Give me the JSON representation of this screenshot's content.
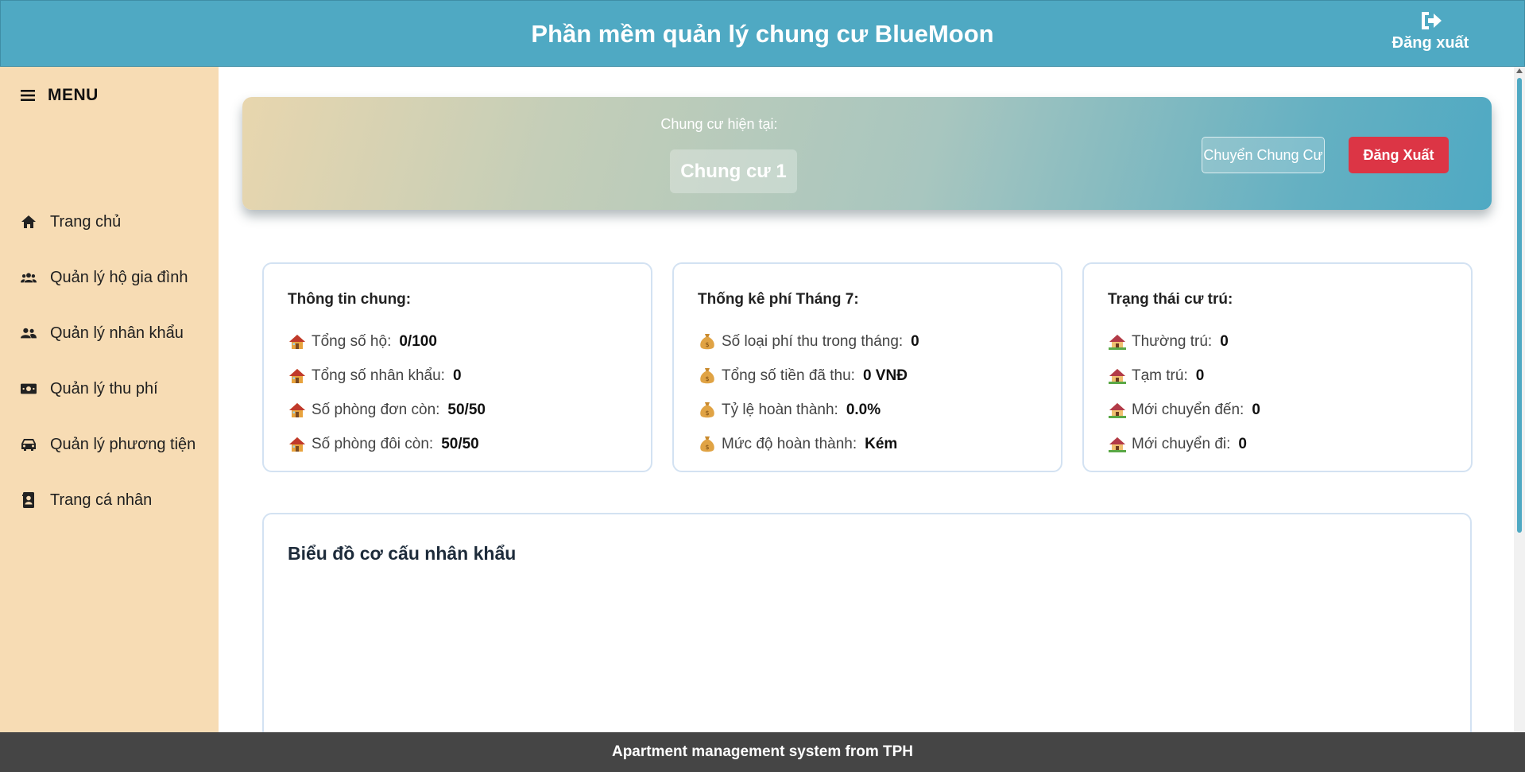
{
  "header": {
    "title": "Phần mềm quản lý chung cư BlueMoon",
    "logout_label": "Đăng xuất",
    "background_color": "#4fa9c3"
  },
  "sidebar": {
    "menu_label": "MENU",
    "background_color": "#f7dcb4",
    "items": [
      {
        "label": "Trang chủ",
        "icon": "home-icon"
      },
      {
        "label": "Quản lý hộ gia đình",
        "icon": "users-icon"
      },
      {
        "label": "Quản lý nhân khẩu",
        "icon": "user-friends-icon"
      },
      {
        "label": "Quản lý thu phí",
        "icon": "money-bill-icon"
      },
      {
        "label": "Quản lý phương tiện",
        "icon": "car-icon"
      },
      {
        "label": "Trang cá nhân",
        "icon": "address-book-icon"
      }
    ]
  },
  "hero": {
    "caption": "Chung cư hiện tại:",
    "current_building": "Chung cư 1",
    "switch_label": "Chuyển Chung Cư",
    "logout_label": "Đăng Xuất"
  },
  "cards": [
    {
      "title": "Thông tin chung:",
      "icon": "house-emoji",
      "rows": [
        {
          "label": "Tổng số hộ:",
          "value": "0/100"
        },
        {
          "label": "Tổng số nhân khẩu:",
          "value": "0"
        },
        {
          "label": "Số phòng đơn còn:",
          "value": "50/50"
        },
        {
          "label": "Số phòng đôi còn:",
          "value": "50/50"
        }
      ]
    },
    {
      "title": "Thống kê phí Tháng 7:",
      "icon": "money-bag-emoji",
      "rows": [
        {
          "label": "Số loại phí thu trong tháng:",
          "value": "0"
        },
        {
          "label": "Tổng số tiền đã thu:",
          "value": "0 VNĐ"
        },
        {
          "label": "Tỷ lệ hoàn thành:",
          "value": "0.0%"
        },
        {
          "label": "Mức độ hoàn thành:",
          "value": "Kém"
        }
      ]
    },
    {
      "title": "Trạng thái cư trú:",
      "icon": "house-garden-emoji",
      "rows": [
        {
          "label": "Thường trú:",
          "value": "0"
        },
        {
          "label": "Tạm trú:",
          "value": "0"
        },
        {
          "label": "Mới chuyển đến:",
          "value": "0"
        },
        {
          "label": "Mới chuyển đi:",
          "value": "0"
        }
      ]
    }
  ],
  "chart_section": {
    "title": "Biểu đồ cơ cấu nhân khẩu"
  },
  "footer": {
    "text": "Apartment management system from TPH"
  }
}
